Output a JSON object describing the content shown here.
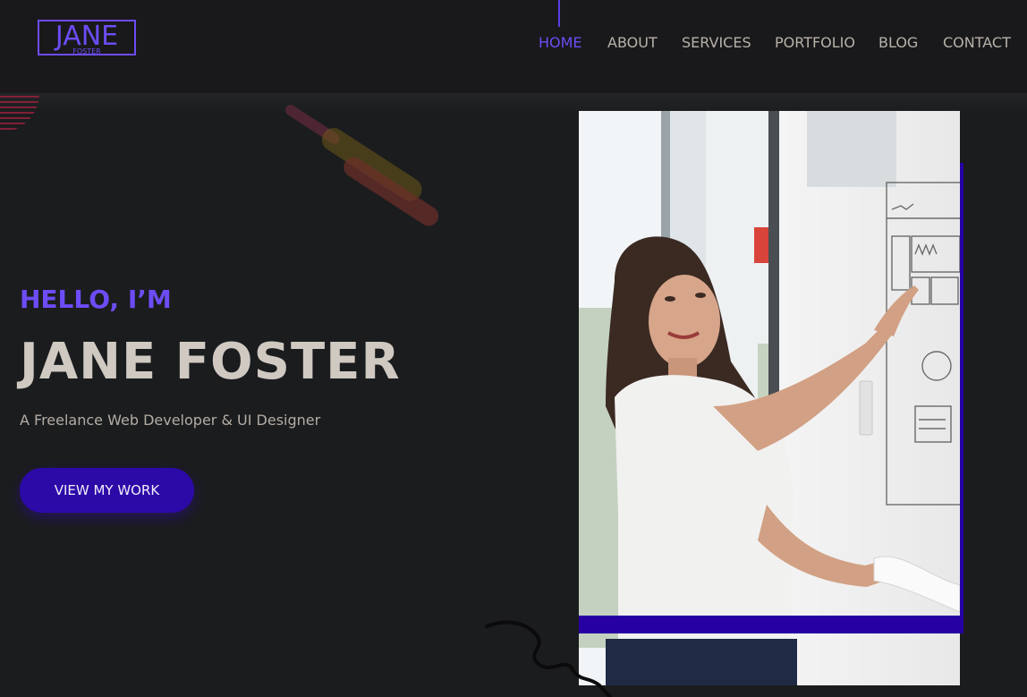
{
  "logo": {
    "main": "JANE",
    "sub": "FOSTER"
  },
  "nav": {
    "items": [
      {
        "label": "HOME",
        "active": true
      },
      {
        "label": "ABOUT",
        "active": false
      },
      {
        "label": "SERVICES",
        "active": false
      },
      {
        "label": "PORTFOLIO",
        "active": false
      },
      {
        "label": "BLOG",
        "active": false
      },
      {
        "label": "CONTACT",
        "active": false
      }
    ]
  },
  "hero": {
    "greeting": "HELLO, I’M",
    "name": "JANE FOSTER",
    "tagline": "A Freelance Web Developer & UI Designer",
    "cta_label": "VIEW MY WORK"
  },
  "colors": {
    "accent": "#6d4cf6",
    "button": "#2c0aa8",
    "frame": "#2600a3",
    "background": "#1b1c1e",
    "heading": "#cfc9c2"
  }
}
